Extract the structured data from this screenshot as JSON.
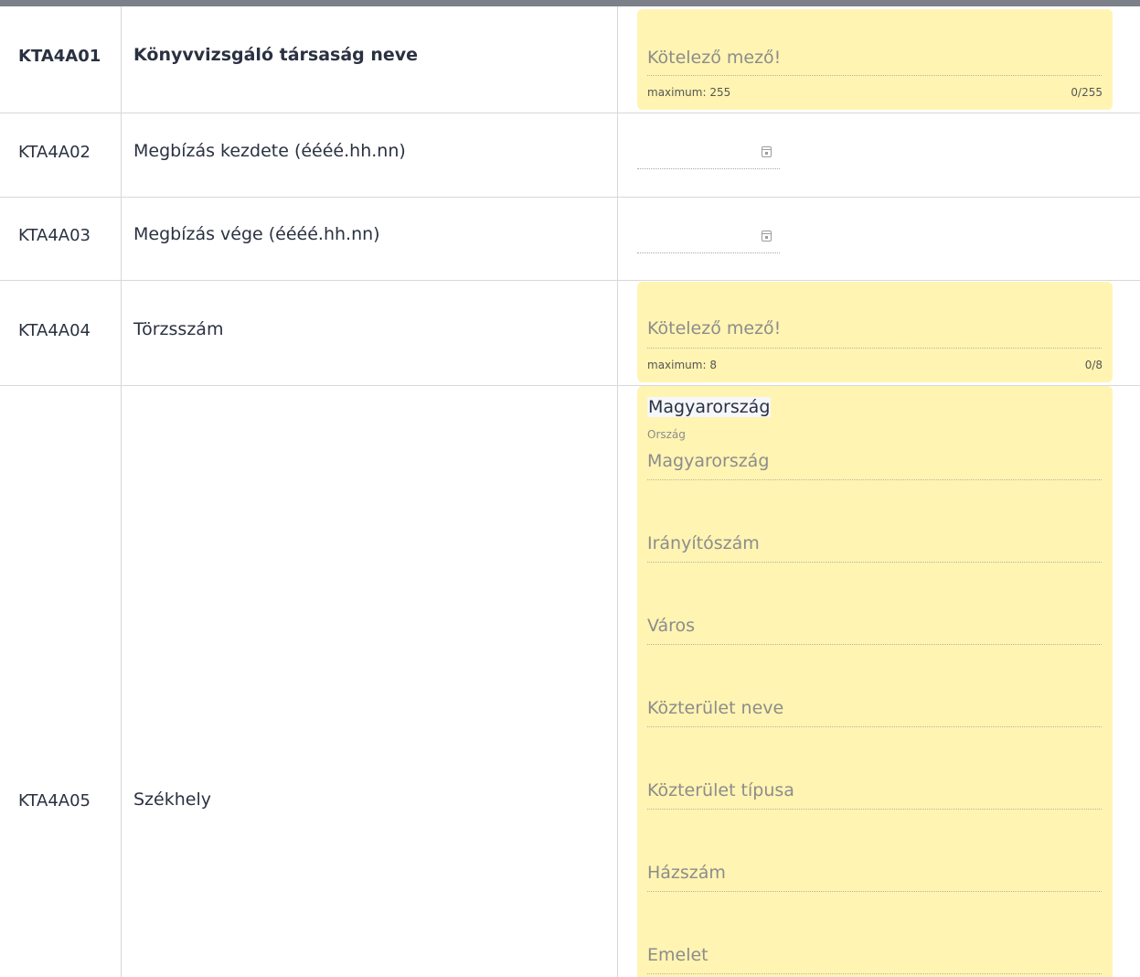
{
  "rows": [
    {
      "code": "KTA4A01",
      "label": "Könyvvizsgáló társaság neve",
      "placeholder": "Kötelező mező!",
      "max_text": "maximum: 255",
      "counter": "0/255"
    },
    {
      "code": "KTA4A02",
      "label": "Megbízás kezdete (éééé.hh.nn)"
    },
    {
      "code": "KTA4A03",
      "label": "Megbízás vége (éééé.hh.nn)"
    },
    {
      "code": "KTA4A04",
      "label": "Törzsszám",
      "placeholder": "Kötelező mező!",
      "max_text": "maximum: 8",
      "counter": "0/8"
    },
    {
      "code": "KTA4A05",
      "label": "Székhely"
    }
  ],
  "address": {
    "country_selected": "Magyarország",
    "country_label": "Ország",
    "fields": [
      "Magyarország",
      "Irányítószám",
      "Város",
      "Közterület neve",
      "Közterület típusa",
      "Házszám",
      "Emelet"
    ]
  },
  "colors": {
    "required_bg": "#fff4b2",
    "topbar": "#7c8088"
  }
}
